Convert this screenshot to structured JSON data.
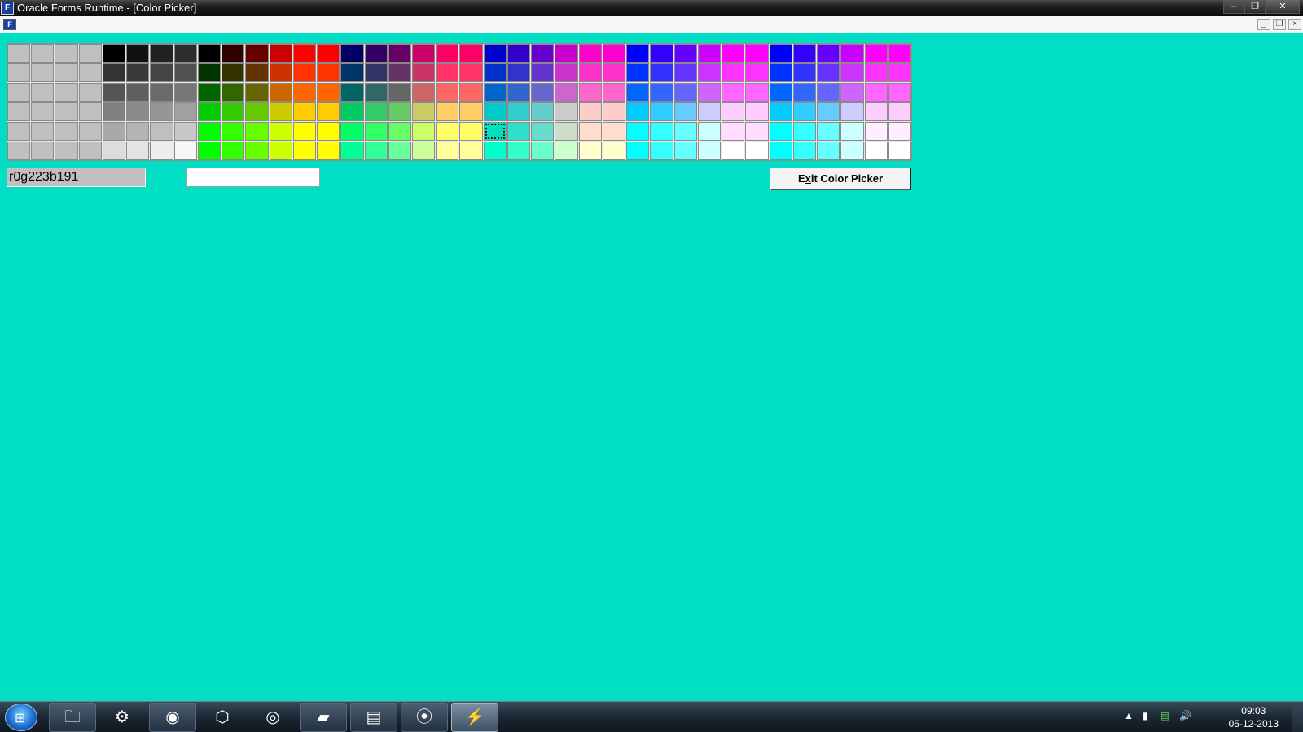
{
  "window": {
    "title": "Oracle Forms Runtime - [Color Picker]",
    "app_icon_text": "F",
    "buttons": {
      "minimize": "–",
      "restore": "❐",
      "close": "✕"
    }
  },
  "mdi": {
    "doc_icon_text": "F",
    "minimize": "_",
    "restore": "❐",
    "close": "×"
  },
  "palette": {
    "columns": 38,
    "rows": 6,
    "selected": {
      "row": 4,
      "col": 20
    },
    "colors": [
      [
        "#c0c0c0",
        "#c0c0c0",
        "#c0c0c0",
        "#c0c0c0",
        "#000000",
        "#111111",
        "#222222",
        "#2e2e2e",
        "#000000",
        "#330000",
        "#660000",
        "#cc0000",
        "#ff0000",
        "#ff0000",
        "#000066",
        "#330066",
        "#660066",
        "#cc0066",
        "#ff0066",
        "#ff0066",
        "#0000cc",
        "#3300cc",
        "#6600cc",
        "#cc00cc",
        "#ff00cc",
        "#ff00cc",
        "#0000ff",
        "#3300ff",
        "#6600ff",
        "#cc00ff",
        "#ff00ff",
        "#ff00ff",
        "#0000ff",
        "#3300ff",
        "#6600ff",
        "#cc00ff",
        "#ff00ff",
        "#ff00ff"
      ],
      [
        "#c0c0c0",
        "#c0c0c0",
        "#c0c0c0",
        "#c0c0c0",
        "#333333",
        "#3a3a3a",
        "#444444",
        "#505050",
        "#003300",
        "#333300",
        "#663300",
        "#cc3300",
        "#ff3300",
        "#ff3300",
        "#003366",
        "#333366",
        "#663366",
        "#cc3366",
        "#ff3366",
        "#ff3366",
        "#0033cc",
        "#3333cc",
        "#6633cc",
        "#cc33cc",
        "#ff33cc",
        "#ff33cc",
        "#0033ff",
        "#3333ff",
        "#6633ff",
        "#cc33ff",
        "#ff33ff",
        "#ff33ff",
        "#0033ff",
        "#3333ff",
        "#6633ff",
        "#cc33ff",
        "#ff33ff",
        "#ff33ff"
      ],
      [
        "#c0c0c0",
        "#c0c0c0",
        "#c0c0c0",
        "#c0c0c0",
        "#555555",
        "#5f5f5f",
        "#6a6a6a",
        "#777777",
        "#006600",
        "#336600",
        "#666600",
        "#cc6600",
        "#ff6600",
        "#ff6600",
        "#006666",
        "#336666",
        "#666666",
        "#cc6666",
        "#ff6666",
        "#ff6666",
        "#0066cc",
        "#3366cc",
        "#6666cc",
        "#cc66cc",
        "#ff66cc",
        "#ff66cc",
        "#0066ff",
        "#3366ff",
        "#6666ff",
        "#cc66ff",
        "#ff66ff",
        "#ff66ff",
        "#0066ff",
        "#3366ff",
        "#6666ff",
        "#cc66ff",
        "#ff66ff",
        "#ff66ff"
      ],
      [
        "#c0c0c0",
        "#c0c0c0",
        "#c0c0c0",
        "#c0c0c0",
        "#808080",
        "#8a8a8a",
        "#969696",
        "#a0a0a0",
        "#00cc00",
        "#33cc00",
        "#66cc00",
        "#cccc00",
        "#ffcc00",
        "#ffcc00",
        "#00cc66",
        "#33cc66",
        "#66cc66",
        "#cccc66",
        "#ffcc66",
        "#ffcc66",
        "#00cccc",
        "#33cccc",
        "#66cccc",
        "#cccccc",
        "#ffcccc",
        "#ffcccc",
        "#00ccff",
        "#33ccff",
        "#66ccff",
        "#ccccff",
        "#ffccff",
        "#ffccff",
        "#00ccff",
        "#33ccff",
        "#66ccff",
        "#ccccff",
        "#ffccff",
        "#ffccff"
      ],
      [
        "#c0c0c0",
        "#c0c0c0",
        "#c0c0c0",
        "#c0c0c0",
        "#a9a9a9",
        "#b4b4b4",
        "#bfbfbf",
        "#c8c8c8",
        "#00ff00",
        "#33ff00",
        "#66ff00",
        "#ccff00",
        "#ffff00",
        "#ffff00",
        "#00ff66",
        "#33ff66",
        "#66ff66",
        "#ccff66",
        "#ffff66",
        "#ffff66",
        "#00dfbf",
        "#33ddcc",
        "#66ddcc",
        "#ccddcc",
        "#ffddcc",
        "#ffddcc",
        "#00ffff",
        "#33ffff",
        "#66ffff",
        "#ccffff",
        "#ffddff",
        "#ffddff",
        "#00ffff",
        "#33ffff",
        "#66ffff",
        "#ccffff",
        "#ffeeff",
        "#ffeeff"
      ],
      [
        "#c0c0c0",
        "#c0c0c0",
        "#c0c0c0",
        "#c0c0c0",
        "#dcdcdc",
        "#e4e4e4",
        "#eeeeee",
        "#f7f7f7",
        "#00ff00",
        "#33ff00",
        "#66ff00",
        "#ccff00",
        "#ffff00",
        "#ffff00",
        "#00ff99",
        "#33ff99",
        "#66ff99",
        "#ccff99",
        "#ffff99",
        "#ffff99",
        "#00ffcc",
        "#33ffcc",
        "#66ffcc",
        "#ccffcc",
        "#ffffcc",
        "#ffffcc",
        "#00ffff",
        "#33ffff",
        "#66ffff",
        "#ccffff",
        "#ffffff",
        "#ffffff",
        "#00ffff",
        "#33ffff",
        "#66ffff",
        "#ccffff",
        "#ffffff",
        "#ffffff"
      ]
    ]
  },
  "fields": {
    "color_name": "r0g223b191",
    "second_value": ""
  },
  "exit_button": {
    "prefix": "E",
    "underlined": "x",
    "suffix": "it Color Picker"
  },
  "colors": {
    "background": "#00dec4"
  },
  "taskbar": {
    "start_glyph": "⊞",
    "items": [
      {
        "name": "explorer-icon",
        "glyph": "🗀"
      },
      {
        "name": "settings-icon",
        "glyph": "⚙"
      },
      {
        "name": "firefox-icon",
        "glyph": "◉"
      },
      {
        "name": "virtualbox-icon",
        "glyph": "⬡"
      },
      {
        "name": "chrome-icon",
        "glyph": "◎"
      },
      {
        "name": "notepad-icon",
        "glyph": "▰"
      },
      {
        "name": "forms-builder-icon",
        "glyph": "▤"
      },
      {
        "name": "podcast-icon",
        "glyph": "⦿"
      },
      {
        "name": "forms-runtime-icon",
        "glyph": "⚡"
      }
    ],
    "tray": {
      "up_arrow": "▲",
      "battery": "▮",
      "network": "▤",
      "volume": "🔊"
    },
    "clock": {
      "time": "09:03",
      "date": "05-12-2013"
    }
  }
}
